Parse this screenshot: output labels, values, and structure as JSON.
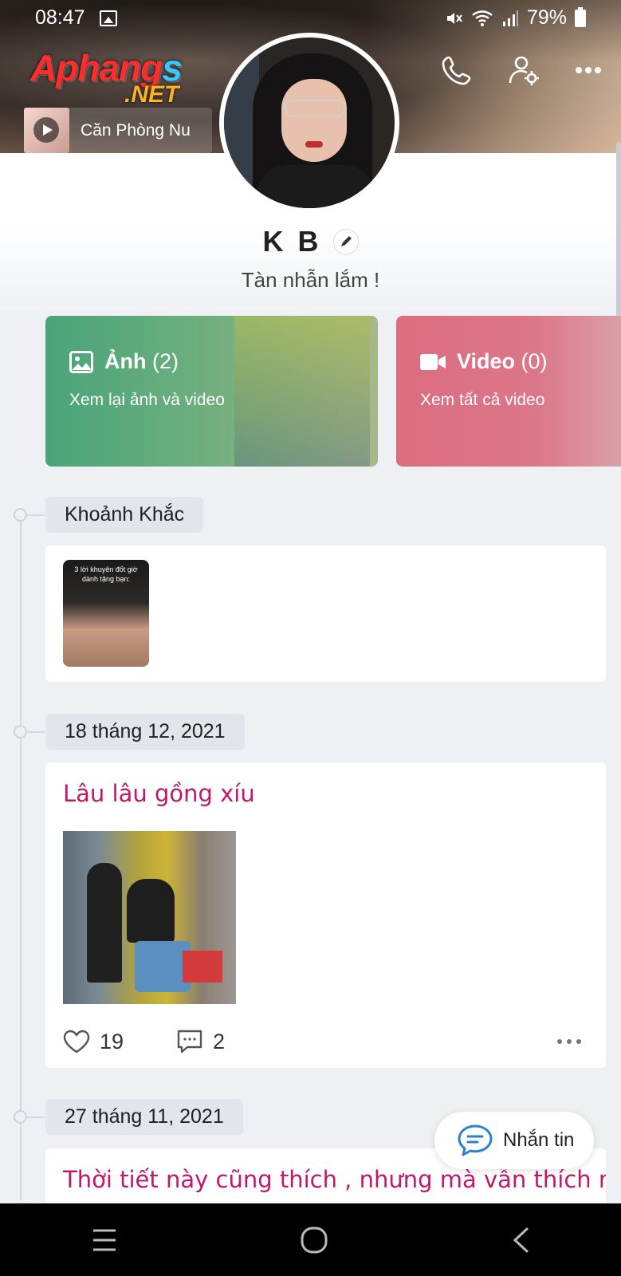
{
  "status_bar": {
    "time": "08:47",
    "battery": "79%"
  },
  "header": {
    "logo_line1_a": "Aphang",
    "logo_line1_b": "s",
    "logo_line2": ".NET",
    "music_title": "Căn Phòng Nu"
  },
  "profile": {
    "name": "K B",
    "status": "Tàn nhẫn lắm !"
  },
  "media": {
    "photos": {
      "label": "Ảnh",
      "count": "(2)",
      "subtitle": "Xem lại ảnh và video"
    },
    "videos": {
      "label": "Video",
      "count": "(0)",
      "subtitle": "Xem tất cả video"
    }
  },
  "timeline": {
    "moments_label": "Khoảnh Khắc",
    "moment_thumb_text": "3 lời khuyên đốt giờ dành tặng bạn:",
    "posts": [
      {
        "date": "18 tháng 12, 2021",
        "title": "Lâu lâu gồng xíu",
        "likes": "19",
        "comments": "2"
      },
      {
        "date": "27 tháng 11, 2021",
        "title": "Thời tiết này cũng thích , nhưng mà vẫn thích nhất"
      }
    ]
  },
  "fab": {
    "label": "Nhắn tin"
  },
  "colors": {
    "accent_post_title": "#c2176b",
    "photos_card": "#49a47a",
    "videos_card": "#dc6c80"
  },
  "icons": [
    "gallery-icon",
    "mute-icon",
    "wifi-icon",
    "signal-icon",
    "battery-icon",
    "play-icon",
    "phone-icon",
    "user-settings-icon",
    "more-icon",
    "edit-icon",
    "image-icon",
    "video-camera-icon",
    "heart-icon",
    "comment-icon",
    "chat-icon",
    "menu-icon",
    "home-icon",
    "back-icon"
  ]
}
